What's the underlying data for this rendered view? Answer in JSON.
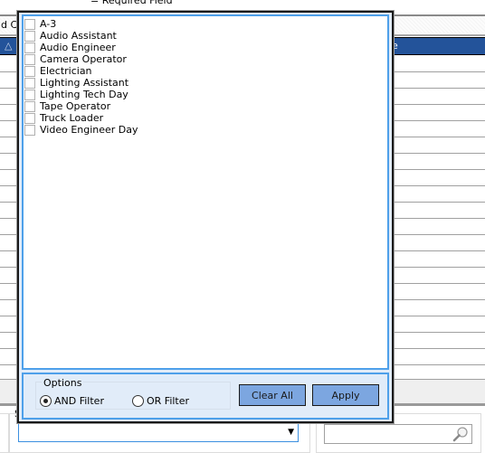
{
  "background": {
    "required_note": "= Required Field",
    "column_header_partial": "d Co",
    "grid_header_right_partial": "e",
    "sort_indicator": "sort-ascending-icon",
    "search_label_partial": "S"
  },
  "filter_popup": {
    "items": [
      {
        "label": "A-3",
        "checked": false
      },
      {
        "label": "Audio Assistant",
        "checked": false
      },
      {
        "label": "Audio Engineer",
        "checked": false
      },
      {
        "label": "Camera Operator",
        "checked": false
      },
      {
        "label": "Electrician",
        "checked": false
      },
      {
        "label": "Lighting Assistant",
        "checked": false
      },
      {
        "label": "Lighting Tech Day",
        "checked": false
      },
      {
        "label": "Tape Operator",
        "checked": false
      },
      {
        "label": "Truck Loader",
        "checked": false
      },
      {
        "label": "Video Engineer Day",
        "checked": false
      }
    ],
    "options": {
      "legend": "Options",
      "and_label": "AND Filter",
      "or_label": "OR Filter",
      "selected": "AND Filter"
    },
    "clear_all_label": "Clear All",
    "apply_label": "Apply"
  },
  "bottom": {
    "combo_value": "",
    "search_value": ""
  },
  "colors": {
    "header_blue": "#23539a",
    "popup_accent": "#4ea0ea",
    "button_fill": "#7ca6e0",
    "popup_bg": "#e1ecf9"
  }
}
